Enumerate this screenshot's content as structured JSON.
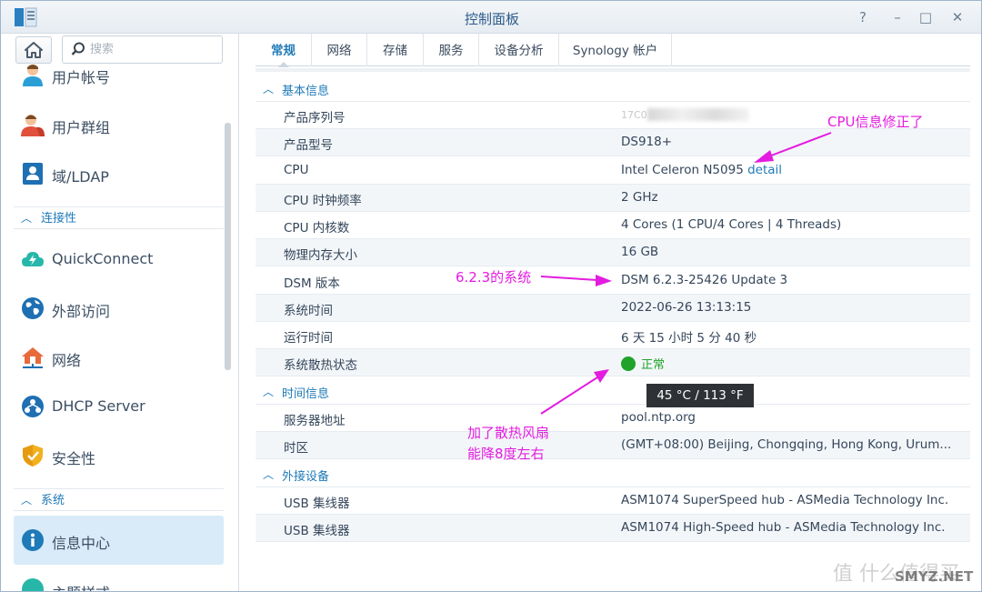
{
  "window": {
    "title": "控制面板",
    "controls": [
      "?",
      "–",
      "□",
      "✕"
    ]
  },
  "sidebar": {
    "search": {
      "placeholder": "搜索"
    },
    "items": [
      {
        "label": "用户帐号",
        "icon": "user-icon"
      },
      {
        "label": "用户群组",
        "icon": "user-group-icon"
      },
      {
        "label": "域/LDAP",
        "icon": "domain-ldap-icon"
      },
      {
        "label": "QuickConnect",
        "icon": "quickconnect-cloud-icon"
      },
      {
        "label": "外部访问",
        "icon": "globe-icon"
      },
      {
        "label": "网络",
        "icon": "network-house-icon"
      },
      {
        "label": "DHCP Server",
        "icon": "dhcp-server-icon"
      },
      {
        "label": "安全性",
        "icon": "shield-icon"
      },
      {
        "label": "信息中心",
        "icon": "info-icon",
        "active": true
      },
      {
        "label": "主题样式",
        "icon": "theme-icon"
      }
    ],
    "groups": [
      {
        "label": "连接性"
      },
      {
        "label": "系统"
      }
    ]
  },
  "tabs": [
    {
      "label": "常规",
      "active": true
    },
    {
      "label": "网络"
    },
    {
      "label": "存储"
    },
    {
      "label": "服务"
    },
    {
      "label": "设备分析"
    },
    {
      "label": "Synology 帐户"
    }
  ],
  "sections": [
    {
      "label": "基本信息"
    },
    {
      "label": "时间信息"
    },
    {
      "label": "外接设备"
    }
  ],
  "basic": {
    "serial": {
      "key": "产品序列号",
      "value": "17C0"
    },
    "model": {
      "key": "产品型号",
      "value": "DS918+"
    },
    "cpu": {
      "key": "CPU",
      "value": "Intel Celeron N5095",
      "link": "detail"
    },
    "cpu_freq": {
      "key": "CPU 时钟频率",
      "value": "2 GHz"
    },
    "cpu_cores": {
      "key": "CPU 内核数",
      "value": "4 Cores (1 CPU/4 Cores | 4 Threads)"
    },
    "memory": {
      "key": "物理内存大小",
      "value": "16 GB"
    },
    "dsm": {
      "key": "DSM 版本",
      "value": "DSM 6.2.3-25426 Update 3"
    },
    "sys_time": {
      "key": "系统时间",
      "value": "2022-06-26 13:13:15"
    },
    "uptime": {
      "key": "运行时间",
      "value": "6 天 15 小时 5 分 40 秒"
    },
    "thermal": {
      "key": "系统散热状态",
      "value": "正常",
      "status_color": "#1fa32b"
    }
  },
  "time": {
    "ntp": {
      "key": "服务器地址",
      "value": "pool.ntp.org"
    },
    "tz": {
      "key": "时区",
      "value": "(GMT+08:00) Beijing, Chongqing, Hong Kong, Urum..."
    }
  },
  "external": {
    "usb1": {
      "key": "USB 集线器",
      "value": "ASM1074 SuperSpeed hub - ASMedia Technology Inc."
    },
    "usb2": {
      "key": "USB 集线器",
      "value": "ASM1074 High-Speed hub - ASMedia Technology Inc."
    }
  },
  "tooltip": {
    "text": "45 °C / 113 °F"
  },
  "annotations": {
    "cpu_fixed": "CPU信息修正了",
    "dsm_version": "6.2.3的系统",
    "fan_line1": "加了散热风扇",
    "fan_line2": "能降8度左右",
    "color": "#e31ce0"
  },
  "watermark": {
    "text1": "值 什么值得买",
    "text2": "SMYZ.NET"
  }
}
